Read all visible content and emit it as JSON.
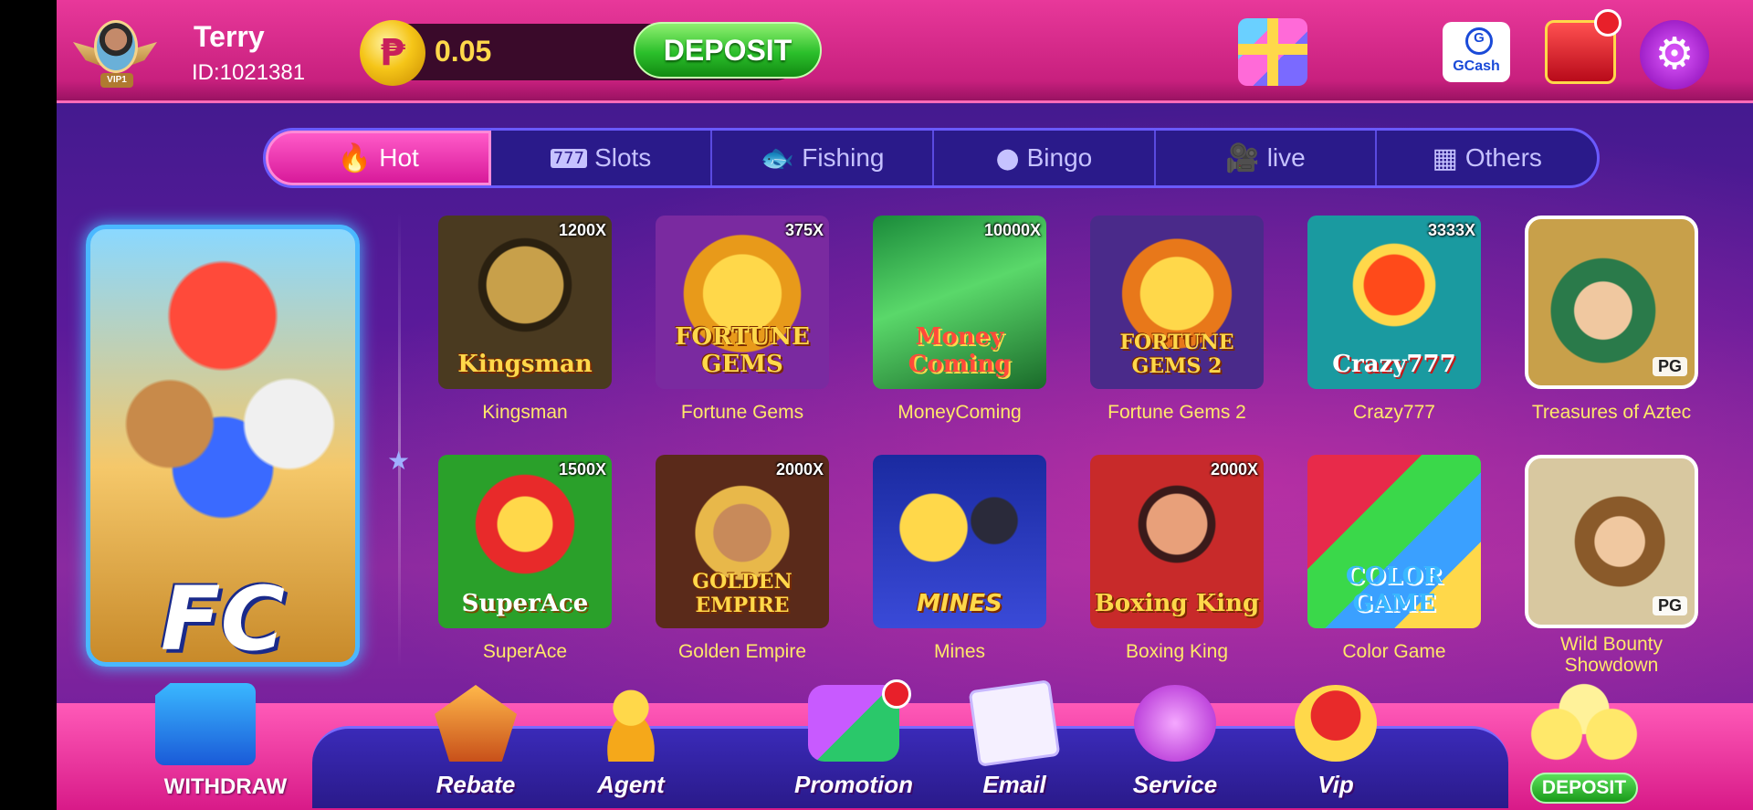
{
  "user": {
    "name": "Terry",
    "id_label": "ID:1021381",
    "vip_label": "VIP1"
  },
  "wallet": {
    "currency_symbol": "₱",
    "balance": "0.05",
    "deposit_label": "DEPOSIT"
  },
  "header_icons": {
    "gift": "gift-icon",
    "gcash_label": "GCash",
    "redbox": "red-envelope-icon",
    "settings": "gear-icon"
  },
  "tabs": [
    {
      "label": "Hot",
      "icon": "flame-icon",
      "glyph": "🔥",
      "active": true
    },
    {
      "label": "Slots",
      "icon": "slots-icon",
      "glyph": "777",
      "active": false
    },
    {
      "label": "Fishing",
      "icon": "fish-icon",
      "glyph": "🐟",
      "active": false
    },
    {
      "label": "Bingo",
      "icon": "bingo-icon",
      "glyph": "●",
      "active": false
    },
    {
      "label": "live",
      "icon": "camera-icon",
      "glyph": "🎥",
      "active": false
    },
    {
      "label": "Others",
      "icon": "grid-icon",
      "glyph": "▦",
      "active": false
    }
  ],
  "featured": {
    "logo_text": "FC"
  },
  "games": [
    {
      "label": "Kingsman",
      "multiplier": "1200X",
      "art_title": "Kingsman",
      "badge": ""
    },
    {
      "label": "Fortune Gems",
      "multiplier": "375X",
      "art_title": "FORTUNE GEMS",
      "badge": ""
    },
    {
      "label": "MoneyComing",
      "multiplier": "10000X",
      "art_title": "Money Coming",
      "badge": ""
    },
    {
      "label": "Fortune Gems 2",
      "multiplier": "",
      "art_title": "FORTUNE GEMS 2",
      "badge": ""
    },
    {
      "label": "Crazy777",
      "multiplier": "3333X",
      "art_title": "Crazy777",
      "badge": ""
    },
    {
      "label": "Treasures of Aztec",
      "multiplier": "",
      "art_title": "",
      "badge": "PG"
    },
    {
      "label": "SuperAce",
      "multiplier": "1500X",
      "art_title": "SuperAce",
      "badge": ""
    },
    {
      "label": "Golden Empire",
      "multiplier": "2000X",
      "art_title": "GOLDEN EMPIRE",
      "badge": ""
    },
    {
      "label": "Mines",
      "multiplier": "",
      "art_title": "MINES",
      "badge": ""
    },
    {
      "label": "Boxing King",
      "multiplier": "2000X",
      "art_title": "Boxing King",
      "badge": ""
    },
    {
      "label": "Color Game",
      "multiplier": "",
      "art_title": "COLOR GAME",
      "badge": ""
    },
    {
      "label": "Wild Bounty Showdown",
      "multiplier": "",
      "art_title": "",
      "badge": "PG"
    }
  ],
  "bottom_nav": {
    "withdraw_label": "WITHDRAW",
    "items": [
      {
        "label": "Rebate",
        "icon": "rebate-icon"
      },
      {
        "label": "Agent",
        "icon": "agent-icon"
      },
      {
        "label": "Promotion",
        "icon": "promotion-gift-icon"
      },
      {
        "label": "Email",
        "icon": "envelope-icon"
      },
      {
        "label": "Service",
        "icon": "chat-bubble-icon"
      },
      {
        "label": "Vip",
        "icon": "vip-badge-icon"
      }
    ],
    "deposit_label": "DEPOSIT"
  },
  "colors": {
    "accent_pink": "#e8389a",
    "tab_active": "#d81a9a",
    "deposit_green": "#2bbf2b",
    "game_label": "#ffe86a"
  }
}
